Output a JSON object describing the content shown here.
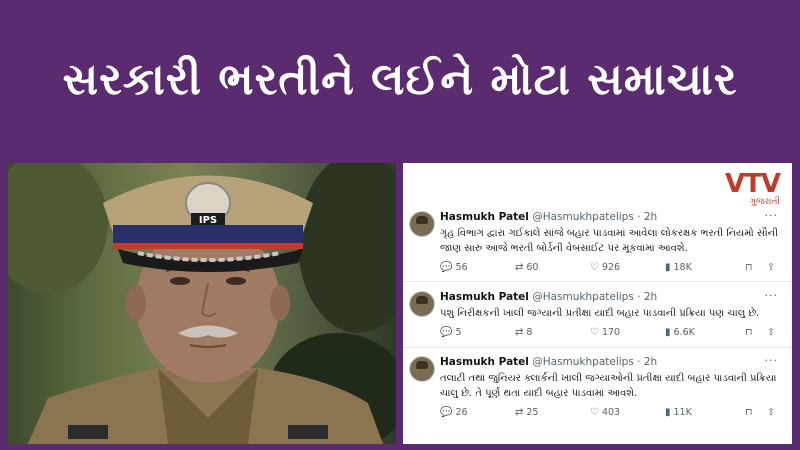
{
  "banner": {
    "title": "સરકારી ભરતીને લઈને મોટા સમાચાર"
  },
  "photo": {
    "cap_badge": "IPS"
  },
  "logo": {
    "main": "VTV",
    "sub": "ગુજરાતી"
  },
  "tweets": [
    {
      "name": "Hasmukh Patel",
      "handle": "@Hasmukhpatelips",
      "time": "· 2h",
      "text": "ગૃહ વિભાગ દ્વારા ગઈકાલે સાંજે બહાર પાડવામાં આવેલા લોકરક્ષક ભરતી નિયમો સૌની જાણ સારુ આજે ભરતી બોર્ડની વેબસાઈટ પર મૂકવામાં આવશે.",
      "replies": "56",
      "retweets": "60",
      "likes": "926",
      "views": "18K"
    },
    {
      "name": "Hasmukh Patel",
      "handle": "@Hasmukhpatelips",
      "time": "· 2h",
      "text": "પશુ નિરીક્ષકની ખાલી જગ્યાની પ્રતીક્ષા યાદી બહાર પાડવાની પ્રક્રિયા પણ ચાલુ છે.",
      "replies": "5",
      "retweets": "8",
      "likes": "170",
      "views": "6.6K"
    },
    {
      "name": "Hasmukh Patel",
      "handle": "@Hasmukhpatelips",
      "time": "· 2h",
      "text": "તલાટી તથા જુનિયર ક્લાર્કની ખાલી જગ્યાઓની પ્રતીક્ષા યાદી બહાર પાડવાની પ્રક્રિયા ચાલુ છે. તે પૂર્ણ થતા યાદી બહાર પાડવામાં આવશે.",
      "replies": "26",
      "retweets": "25",
      "likes": "403",
      "views": "11K"
    }
  ],
  "colors": {
    "banner_bg": "#5a2b6e",
    "logo_red": "#c0392b",
    "text_gray": "#536471"
  },
  "icons": [
    "reply-icon",
    "retweet-icon",
    "like-icon",
    "views-icon",
    "bookmark-icon",
    "share-icon",
    "more-icon"
  ]
}
